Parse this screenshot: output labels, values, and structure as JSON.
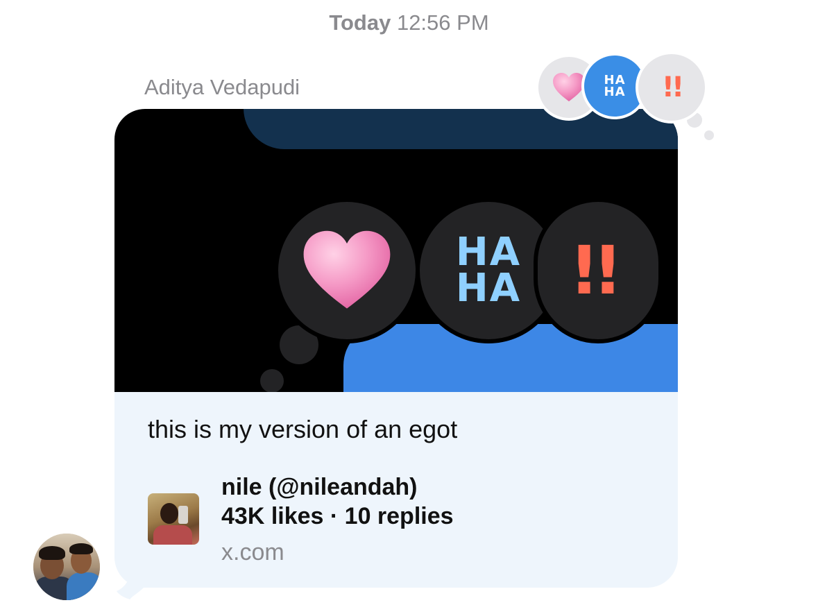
{
  "timestamp": {
    "day": "Today",
    "time": "12:56 PM"
  },
  "message": {
    "sender": "Aditya Vedapudi",
    "caption": "this is my version of an egot",
    "tapbacks": {
      "heart_icon": "pink-heart-icon",
      "haha_line1": "HA",
      "haha_line2": "HA",
      "emphasis": "!!"
    },
    "preview_image": {
      "haha_line1": "HA",
      "haha_line2": "HA",
      "emphasis": "!!"
    },
    "link": {
      "title": "nile (@nileandah)",
      "stats": "43K likes · 10 replies",
      "domain": "x.com"
    }
  },
  "colors": {
    "bubble_bg": "#eef5fc",
    "meta_gray": "#8a8a8e",
    "haha_blue": "#3a8ee6",
    "heart_pink": "#f39ac6",
    "exclaim_red": "#ff6a50"
  }
}
